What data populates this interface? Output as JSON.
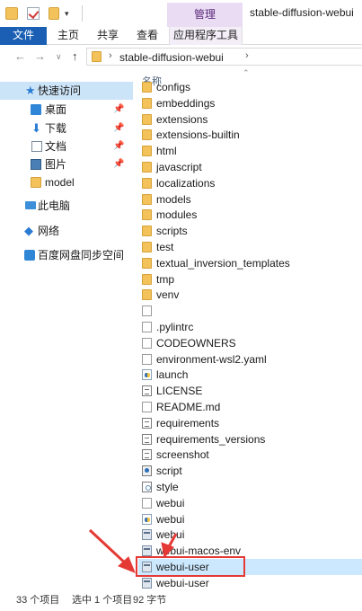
{
  "window": {
    "title": "stable-diffusion-webui",
    "manage_tab": "管理"
  },
  "ribbon": {
    "tabs": [
      "文件",
      "主页",
      "共享",
      "查看",
      "应用程序工具"
    ]
  },
  "address": {
    "path": "stable-diffusion-webui"
  },
  "navpane": {
    "items": [
      {
        "label": "快速访问",
        "icon": "star-icon"
      },
      {
        "label": "桌面",
        "icon": "desktop-icon",
        "pinned": true
      },
      {
        "label": "下载",
        "icon": "download-icon",
        "pinned": true
      },
      {
        "label": "文档",
        "icon": "document-icon",
        "pinned": true
      },
      {
        "label": "图片",
        "icon": "pictures-icon",
        "pinned": true
      },
      {
        "label": "model",
        "icon": "folder-icon"
      },
      {
        "label": "此电脑",
        "icon": "this-pc-icon"
      },
      {
        "label": "网络",
        "icon": "network-icon"
      },
      {
        "label": "百度网盘同步空间",
        "icon": "baidu-netdisk-icon"
      }
    ]
  },
  "filelist": {
    "column_name": "名称",
    "files": [
      {
        "name": "configs",
        "type": "folder"
      },
      {
        "name": "embeddings",
        "type": "folder"
      },
      {
        "name": "extensions",
        "type": "folder"
      },
      {
        "name": "extensions-builtin",
        "type": "folder"
      },
      {
        "name": "html",
        "type": "folder"
      },
      {
        "name": "javascript",
        "type": "folder"
      },
      {
        "name": "localizations",
        "type": "folder"
      },
      {
        "name": "models",
        "type": "folder"
      },
      {
        "name": "modules",
        "type": "folder"
      },
      {
        "name": "scripts",
        "type": "folder"
      },
      {
        "name": "test",
        "type": "folder"
      },
      {
        "name": "textual_inversion_templates",
        "type": "folder"
      },
      {
        "name": "tmp",
        "type": "folder"
      },
      {
        "name": "venv",
        "type": "folder"
      },
      {
        "name": "",
        "type": "file"
      },
      {
        "name": ".pylintrc",
        "type": "file"
      },
      {
        "name": "CODEOWNERS",
        "type": "file"
      },
      {
        "name": "environment-wsl2.yaml",
        "type": "file"
      },
      {
        "name": "launch",
        "type": "py"
      },
      {
        "name": "LICENSE",
        "type": "doc"
      },
      {
        "name": "README.md",
        "type": "file"
      },
      {
        "name": "requirements",
        "type": "doc"
      },
      {
        "name": "requirements_versions",
        "type": "doc"
      },
      {
        "name": "screenshot",
        "type": "doc"
      },
      {
        "name": "script",
        "type": "script"
      },
      {
        "name": "style",
        "type": "css"
      },
      {
        "name": "webui",
        "type": "file"
      },
      {
        "name": "webui",
        "type": "py"
      },
      {
        "name": "webui",
        "type": "bat"
      },
      {
        "name": "webui-macos-env",
        "type": "bat"
      },
      {
        "name": "webui-user",
        "type": "bat",
        "selected": true
      },
      {
        "name": "webui-user",
        "type": "bat"
      }
    ]
  },
  "status": {
    "count": "33 个项目",
    "selected": "选中 1 个项目",
    "size": "92 字节"
  },
  "colors": {
    "accent": "#1a5fb4",
    "selection": "#cce8ff",
    "highlight": "#e53935",
    "folder": "#f4c25a"
  }
}
